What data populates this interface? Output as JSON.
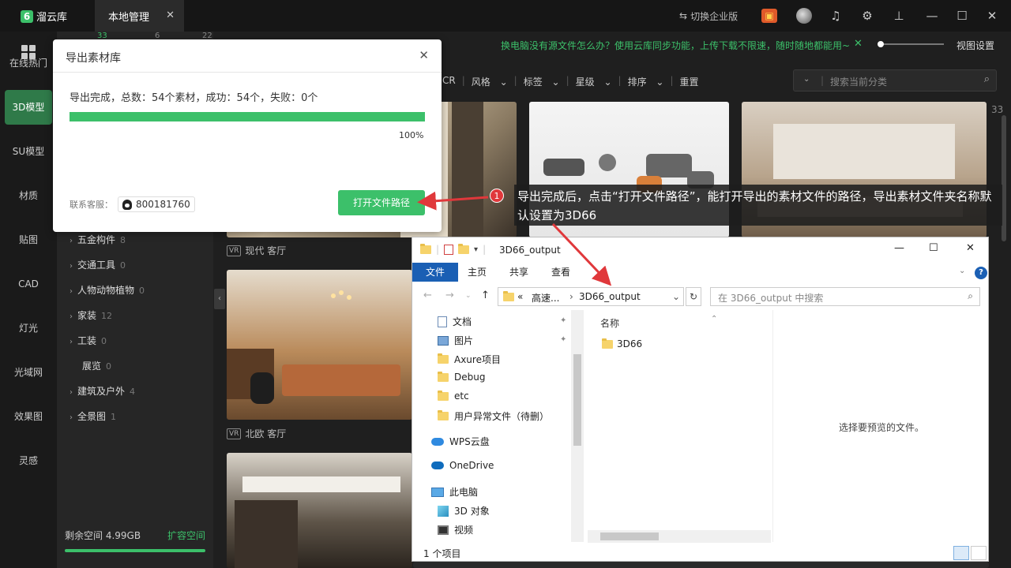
{
  "app": {
    "logo_char": "6",
    "name": "溜云库",
    "active_tab": "本地管理",
    "switch_enterprise": "切换企业版"
  },
  "nav": {
    "items": [
      "在线热门",
      "3D模型",
      "SU模型",
      "材质",
      "贴图",
      "CAD",
      "灯光",
      "光域网",
      "效果图",
      "灵感"
    ],
    "active": "3D模型"
  },
  "top_counts": [
    "33",
    "6",
    "22"
  ],
  "categories": [
    {
      "name": "五金构件",
      "count": "8",
      "arrow": true
    },
    {
      "name": "交通工具",
      "count": "0",
      "arrow": true
    },
    {
      "name": "人物动物植物",
      "count": "0",
      "arrow": true
    },
    {
      "name": "家装",
      "count": "12",
      "arrow": true
    },
    {
      "name": "工装",
      "count": "0",
      "arrow": true
    },
    {
      "name": "展览",
      "count": "0",
      "arrow": false
    },
    {
      "name": "建筑及户外",
      "count": "4",
      "arrow": true
    },
    {
      "name": "全景图",
      "count": "1",
      "arrow": true
    }
  ],
  "storage": {
    "label": "剩余空间 4.99GB",
    "expand": "扩容空间"
  },
  "notice": {
    "text": "换电脑没有源文件怎么办？使用云库同步功能，上传下载不限速，随时随地都能用~",
    "close": "✕"
  },
  "view_settings": "视图设置",
  "filters": {
    "items": [
      "CR",
      "风格",
      "标签",
      "星级",
      "排序"
    ],
    "reset": "重置"
  },
  "search": {
    "placeholder": "搜索当前分类"
  },
  "page_count": "33",
  "cards": [
    {
      "vr": "VR",
      "caption": "现代 客厅"
    },
    {
      "vr": "VR",
      "caption": "北欧 客厅"
    }
  ],
  "dialog": {
    "title": "导出素材库",
    "message": "导出完成，总数：54个素材，成功：54个，失败：0个",
    "progress": 1.0,
    "progress_label": "100%",
    "support_label": "联系客服：",
    "qq_number": "800181760",
    "open_path_button": "打开文件路径"
  },
  "annotation": {
    "number": "1",
    "text": "导出完成后，点击“打开文件路径”，能打开导出的素材文件的路径，导出素材文件夹名称默认设置为3D66"
  },
  "explorer": {
    "title": "3D66_output",
    "ribbon_tabs": [
      "文件",
      "主页",
      "共享",
      "查看"
    ],
    "address": {
      "prefix": "«",
      "parent": "高速...",
      "current": "3D66_output"
    },
    "search_placeholder": "在 3D66_output 中搜索",
    "tree": [
      {
        "name": "文档",
        "icon": "document-icon",
        "pinned": true
      },
      {
        "name": "图片",
        "icon": "picture-icon",
        "pinned": true
      },
      {
        "name": "Axure项目",
        "icon": "folder-icon",
        "pinned": false
      },
      {
        "name": "Debug",
        "icon": "folder-icon",
        "pinned": false
      },
      {
        "name": "etc",
        "icon": "folder-icon",
        "pinned": false
      },
      {
        "name": "用户异常文件（待删）",
        "icon": "folder-icon",
        "pinned": false
      },
      {
        "name": "WPS云盘",
        "icon": "cloud-icon",
        "pinned": false
      },
      {
        "name": "OneDrive",
        "icon": "cloud-icon",
        "pinned": false
      },
      {
        "name": "此电脑",
        "icon": "computer-icon",
        "pinned": false
      },
      {
        "name": "3D 对象",
        "icon": "cube-icon",
        "pinned": false
      },
      {
        "name": "视频",
        "icon": "video-icon",
        "pinned": false
      }
    ],
    "column_header": "名称",
    "files": [
      "3D66"
    ],
    "preview_text": "选择要预览的文件。",
    "status": "1 个项目"
  },
  "colors": {
    "accent": "#3cc06a",
    "annotation_red": "#e0383b",
    "explorer_blue": "#1a5fb4"
  }
}
